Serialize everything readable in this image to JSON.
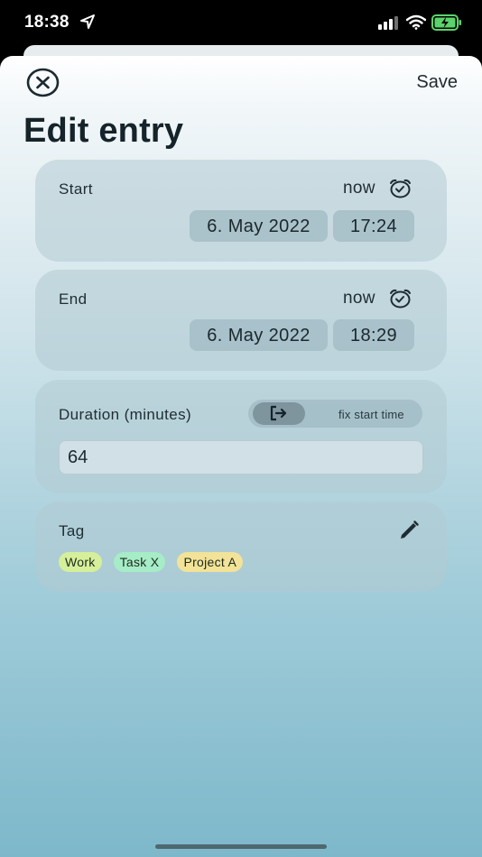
{
  "status_bar": {
    "time": "18:38"
  },
  "header": {
    "save_label": "Save",
    "title": "Edit entry"
  },
  "start": {
    "label": "Start",
    "now_label": "now",
    "date": "6. May 2022",
    "time": "17:24"
  },
  "end": {
    "label": "End",
    "now_label": "now",
    "date": "6. May 2022",
    "time": "18:29"
  },
  "duration": {
    "label": "Duration (minutes)",
    "toggle_text": "fix start time",
    "value": "64"
  },
  "tag": {
    "label": "Tag",
    "chips": [
      {
        "label": "Work",
        "color": "#d6ef9a"
      },
      {
        "label": "Task X",
        "color": "#a6ecc6"
      },
      {
        "label": "Project A",
        "color": "#f2e398"
      }
    ]
  },
  "colors": {
    "title_text": "#15232a",
    "sheet_top": "#ffffff",
    "sheet_bottom": "#7db8ca"
  }
}
